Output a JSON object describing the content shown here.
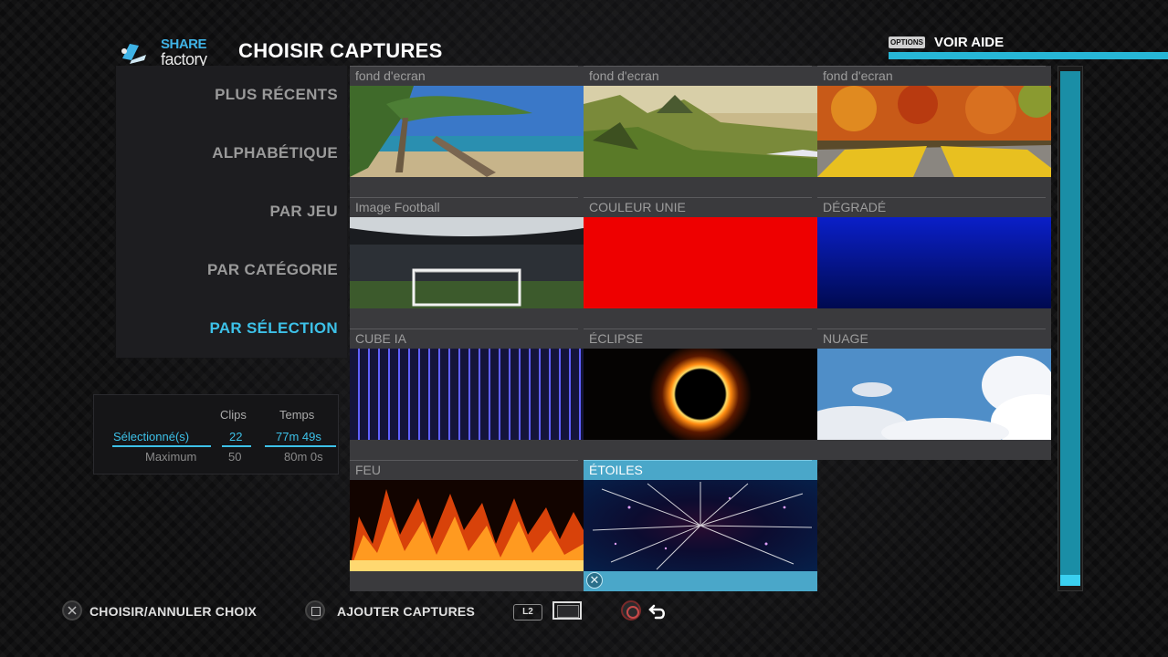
{
  "app": {
    "logo_share": "SHARE",
    "logo_factory": "factory"
  },
  "header": {
    "title": "CHOISIR CAPTURES",
    "options_badge": "OPTIONS",
    "help_label": "VOIR AIDE"
  },
  "menu": {
    "items": [
      {
        "label": "PLUS RÉCENTS"
      },
      {
        "label": "ALPHABÉTIQUE"
      },
      {
        "label": "PAR JEU"
      },
      {
        "label": "PAR CATÉGORIE"
      },
      {
        "label": "PAR SÉLECTION",
        "active": true
      }
    ]
  },
  "stats": {
    "col_clips": "Clips",
    "col_time": "Temps",
    "selected_label": "Sélectionné(s)",
    "selected_clips": "22",
    "selected_time": "77m 49s",
    "max_label": "Maximum",
    "max_clips": "50",
    "max_time": "80m 0s"
  },
  "grid": {
    "items": [
      {
        "label": "fond d'ecran",
        "icon": "beach-image"
      },
      {
        "label": "fond d'ecran",
        "icon": "mountain-image"
      },
      {
        "label": "fond d'ecran",
        "icon": "autumn-road-image"
      },
      {
        "label": "Image Football",
        "icon": "stadium-image"
      },
      {
        "label": "COULEUR UNIE",
        "icon": "solid-red-image"
      },
      {
        "label": "DÉGRADÉ",
        "icon": "blue-gradient-image"
      },
      {
        "label": "CUBE IA",
        "icon": "vertical-lines-image"
      },
      {
        "label": "ÉCLIPSE",
        "icon": "eclipse-image"
      },
      {
        "label": "NUAGE",
        "icon": "clouds-image"
      },
      {
        "label": "FEU",
        "icon": "fire-image"
      },
      {
        "label": "ÉTOILES",
        "icon": "stars-image",
        "selected": true
      }
    ]
  },
  "footer": {
    "choose_label": "CHOISIR/ANNULER CHOIX",
    "add_label": "AJOUTER CAPTURES",
    "l2_label": "L2"
  },
  "colors": {
    "accent": "#3dc1e8",
    "red": "#ee0000"
  }
}
